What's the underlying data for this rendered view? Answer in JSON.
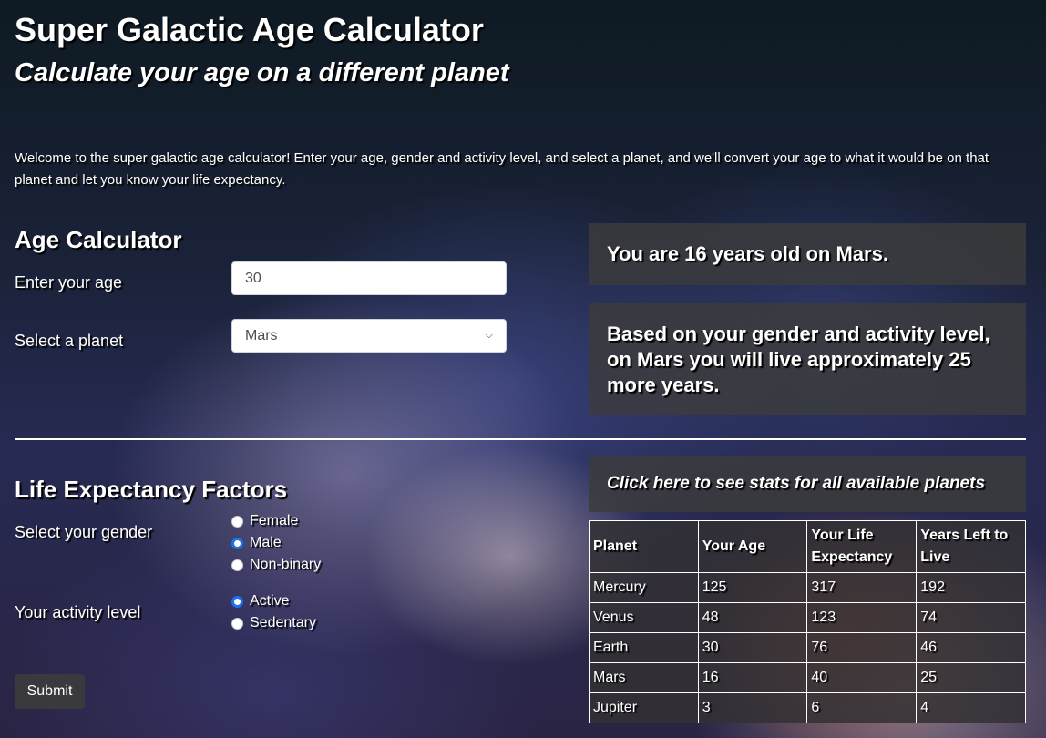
{
  "header": {
    "title": "Super Galactic Age Calculator",
    "subtitle": "Calculate your age on a different planet"
  },
  "intro": "Welcome to the super galactic age calculator! Enter your age, gender and activity level, and select a planet, and we'll convert your age to what it would be on that planet and let you know your life expectancy.",
  "age_calculator": {
    "heading": "Age Calculator",
    "age_label": "Enter your age",
    "age_value": "30",
    "planet_label": "Select a planet",
    "planet_value": "Mars"
  },
  "results": {
    "age_result": "You are 16 years old on Mars.",
    "life_result": "Based on your gender and activity level, on Mars you will live approximately 25 more years."
  },
  "factors": {
    "heading": "Life Expectancy Factors",
    "gender_label": "Select your gender",
    "genders": [
      {
        "label": "Female",
        "checked": false
      },
      {
        "label": "Male",
        "checked": true
      },
      {
        "label": "Non-binary",
        "checked": false
      }
    ],
    "activity_label": "Your activity level",
    "activities": [
      {
        "label": "Active",
        "checked": true
      },
      {
        "label": "Sedentary",
        "checked": false
      }
    ],
    "submit": "Submit"
  },
  "stats": {
    "toggle": "Click here to see stats for all available planets",
    "headers": [
      "Planet",
      "Your Age",
      "Your Life Expectancy",
      "Years Left to Live"
    ],
    "rows": [
      [
        "Mercury",
        "125",
        "317",
        "192"
      ],
      [
        "Venus",
        "48",
        "123",
        "74"
      ],
      [
        "Earth",
        "30",
        "76",
        "46"
      ],
      [
        "Mars",
        "16",
        "40",
        "25"
      ],
      [
        "Jupiter",
        "3",
        "6",
        "4"
      ]
    ]
  },
  "colors": {
    "accent": "#1a73e8",
    "panel": "#3c3c3c"
  }
}
